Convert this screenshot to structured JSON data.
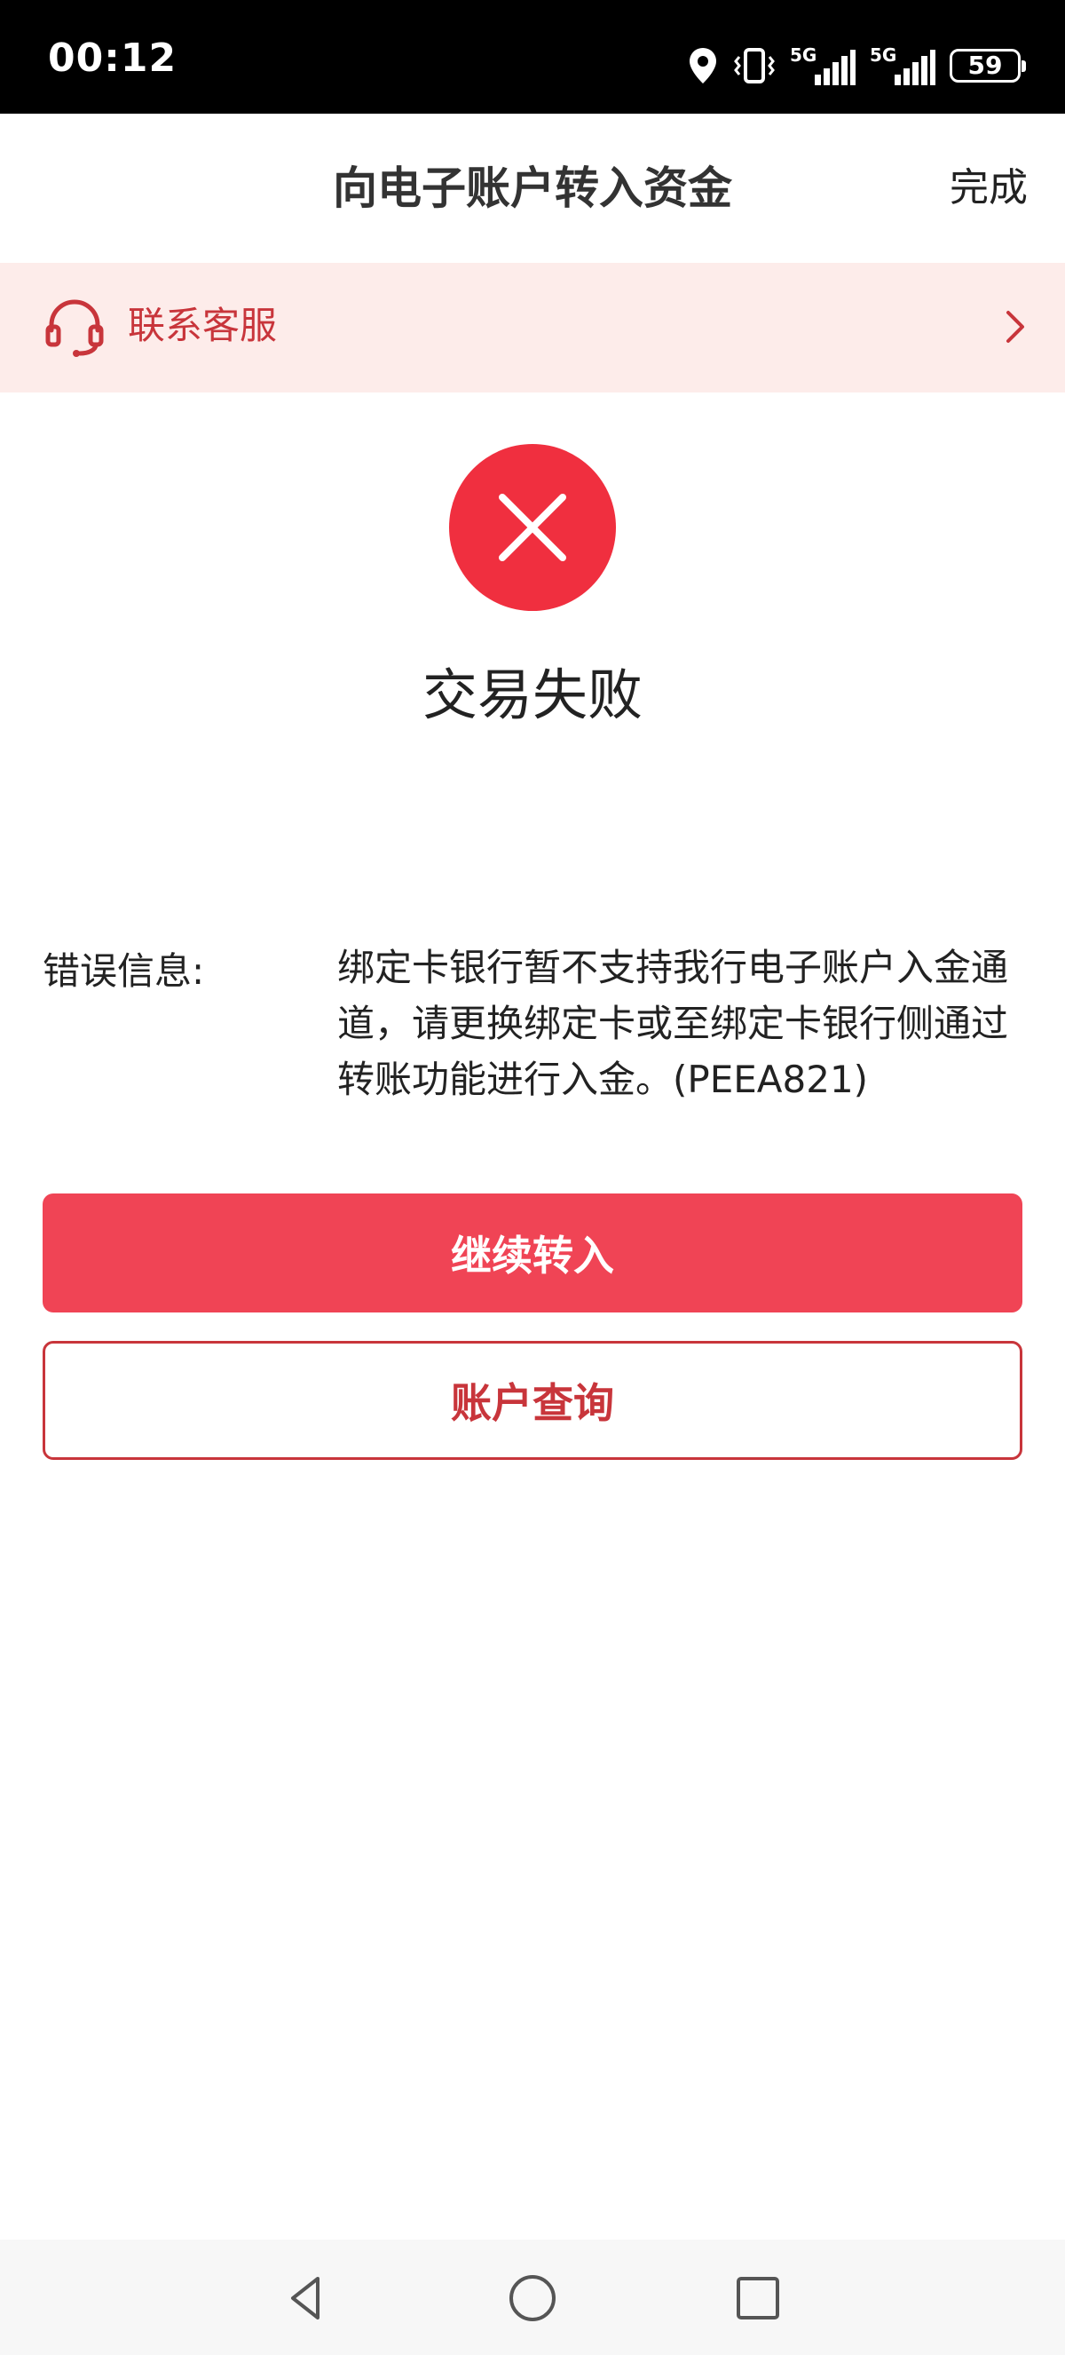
{
  "status_bar": {
    "time": "00:12",
    "network_1": "5G",
    "network_2": "5G",
    "battery": "59"
  },
  "header": {
    "title": "向电子账户转入资金",
    "done_label": "完成"
  },
  "service_banner": {
    "label": "联系客服"
  },
  "result": {
    "title": "交易失败"
  },
  "error": {
    "label": "错误信息:",
    "message": "绑定卡银行暂不支持我行电子账户入金通道，请更换绑定卡或至绑定卡银行侧通过转账功能进行入金。(PEEA821)"
  },
  "buttons": {
    "continue_label": "继续转入",
    "query_label": "账户查询"
  },
  "colors": {
    "accent_red": "#f04455",
    "error_icon": "#f02f3f",
    "banner_bg": "#fdecea",
    "banner_text": "#c8353b"
  },
  "icons": {
    "location": "location-pin-icon",
    "vibrate": "vibrate-icon",
    "signal": "signal-bars-icon",
    "service": "headset-icon",
    "chevron": "chevron-right-icon",
    "result": "close-x-icon",
    "nav_back": "triangle-back-icon",
    "nav_home": "circle-home-icon",
    "nav_recent": "square-recent-icon"
  }
}
